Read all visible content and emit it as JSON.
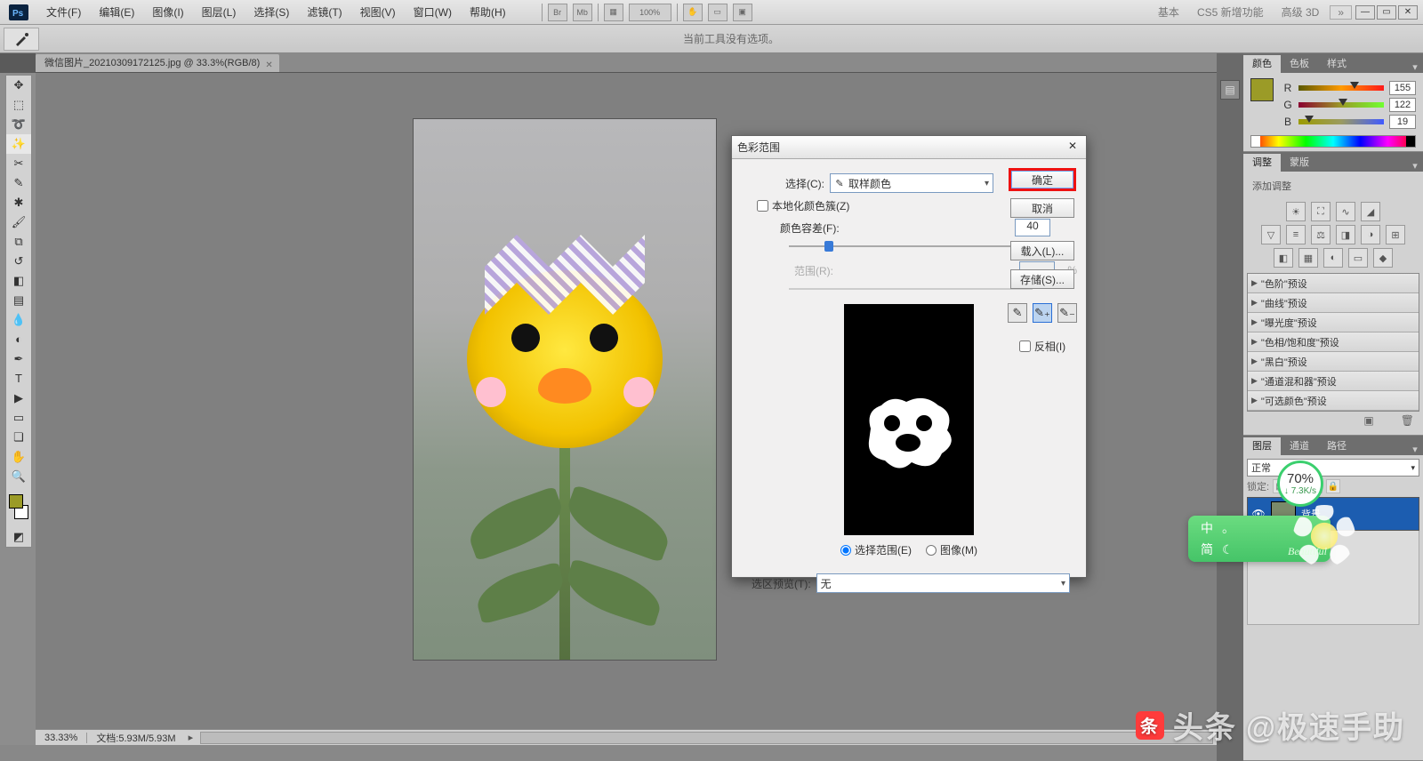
{
  "menu": {
    "file": "文件(F)",
    "edit": "编辑(E)",
    "image": "图像(I)",
    "layer": "图层(L)",
    "select": "选择(S)",
    "filter": "滤镜(T)",
    "view": "视图(V)",
    "window": "窗口(W)",
    "help": "帮助(H)"
  },
  "menu_mid": {
    "zoom": "100%"
  },
  "top_links": {
    "basic": "基本",
    "cs5": "CS5 新增功能",
    "adv3d": "高级 3D"
  },
  "options_bar": {
    "message": "当前工具没有选项。"
  },
  "doc_tab": {
    "title": "微信图片_20210309172125.jpg @ 33.3%(RGB/8)"
  },
  "status_bar": {
    "zoom": "33.33%",
    "docinfo": "文档:5.93M/5.93M"
  },
  "dialog": {
    "title": "色彩范围",
    "select_label": "选择(C):",
    "select_value": "取样颜色",
    "localized": "本地化颜色簇(Z)",
    "fuzziness_label": "颜色容差(F):",
    "fuzziness_value": "40",
    "range_label": "范围(R):",
    "range_unit": "%",
    "radio_selection": "选择范围(E)",
    "radio_image": "图像(M)",
    "preview_label": "选区预览(T):",
    "preview_value": "无",
    "ok": "确定",
    "cancel": "取消",
    "load": "载入(L)...",
    "save": "存储(S)...",
    "invert": "反相(I)"
  },
  "color_panel": {
    "tabs": {
      "color": "颜色",
      "swatch": "色板",
      "styles": "样式"
    },
    "r": "R",
    "g": "G",
    "b": "B",
    "r_val": "155",
    "g_val": "122",
    "b_val": "19"
  },
  "adjust_panel": {
    "tabs": {
      "adjust": "调整",
      "mask": "蒙版"
    },
    "add_label": "添加调整",
    "presets": [
      "\"色阶\"预设",
      "\"曲线\"预设",
      "\"曝光度\"预设",
      "\"色相/饱和度\"预设",
      "\"黑白\"预设",
      "\"通道混和器\"预设",
      "\"可选颜色\"预设"
    ]
  },
  "layers_panel": {
    "tabs": {
      "layers": "图层",
      "channels": "通道",
      "paths": "路径"
    },
    "mode": "正常",
    "lock_label": "锁定:",
    "layer_name": "背景"
  },
  "speed": {
    "percent": "70%",
    "rate": "↓ 7.3K/s"
  },
  "ime": {
    "line1": "中",
    "dot": "。",
    "line2": "简",
    "beautiful": "Beautiful"
  },
  "watermark": {
    "prefix": "头条",
    "text": "@极速手助"
  }
}
